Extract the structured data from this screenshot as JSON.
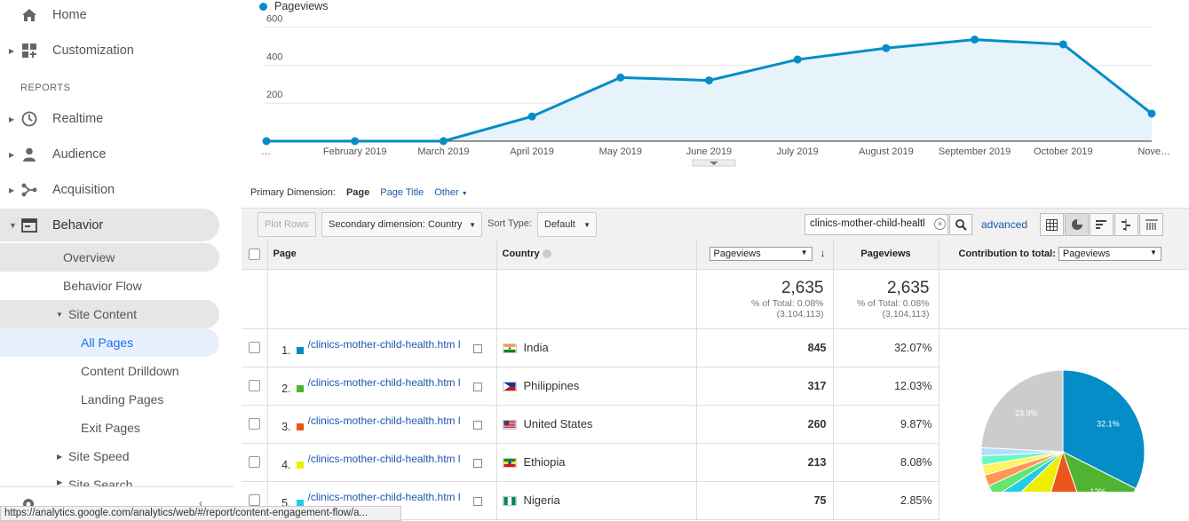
{
  "sidebar": {
    "home": "Home",
    "customization": "Customization",
    "section": "REPORTS",
    "realtime": "Realtime",
    "audience": "Audience",
    "acquisition": "Acquisition",
    "behavior": "Behavior",
    "overview": "Overview",
    "behavior_flow": "Behavior Flow",
    "site_content": "Site Content",
    "all_pages": "All Pages",
    "content_drilldown": "Content Drilldown",
    "landing_pages": "Landing Pages",
    "exit_pages": "Exit Pages",
    "site_speed": "Site Speed",
    "site_search": "Site Search"
  },
  "chart_data": {
    "type": "area",
    "series": [
      {
        "name": "Pageviews",
        "values": [
          0,
          0,
          0,
          130,
          335,
          320,
          430,
          490,
          535,
          510,
          145
        ]
      }
    ],
    "categories": [
      "…",
      "February 2019",
      "March 2019",
      "April 2019",
      "May 2019",
      "June 2019",
      "July 2019",
      "August 2019",
      "September 2019",
      "October 2019",
      "Nove…"
    ],
    "yticks": [
      200,
      400,
      600
    ],
    "ylim": [
      0,
      650
    ],
    "color": "#058dc7",
    "fill": "#e6f3fa",
    "grid": true,
    "legend": "top-left"
  },
  "dimension": {
    "label": "Primary Dimension:",
    "current": "Page",
    "page_title": "Page Title",
    "other": "Other"
  },
  "toolbar": {
    "plot_rows": "Plot Rows",
    "secondary": "Secondary dimension: Country",
    "sort_label": "Sort Type:",
    "sort_value": "Default",
    "search_value": "clinics-mother-child-healtl",
    "advanced": "advanced"
  },
  "table": {
    "headers": {
      "page": "Page",
      "country": "Country",
      "metric_select": "Pageviews",
      "pageviews": "Pageviews",
      "contribution_label": "Contribution to total:",
      "contribution_select": "Pageviews"
    },
    "summary": {
      "total1": "2,635",
      "pct1": "% of Total: 0.08%",
      "abs1": "(3,104,113)",
      "total2": "2,635",
      "pct2": "% of Total: 0.08%",
      "abs2": "(3,104,113)"
    },
    "rows": [
      {
        "index": "1.",
        "page": "/clinics-mother-child-health.htm l",
        "country": "India",
        "views": "845",
        "pct": "32.07%",
        "color": "#058dc7"
      },
      {
        "index": "2.",
        "page": "/clinics-mother-child-health.htm l",
        "country": "Philippines",
        "views": "317",
        "pct": "12.03%",
        "color": "#50b432"
      },
      {
        "index": "3.",
        "page": "/clinics-mother-child-health.htm l",
        "country": "United States",
        "views": "260",
        "pct": "9.87%",
        "color": "#ed561b"
      },
      {
        "index": "4.",
        "page": "/clinics-mother-child-health.htm l",
        "country": "Ethiopia",
        "views": "213",
        "pct": "8.08%",
        "color": "#edef00"
      },
      {
        "index": "5.",
        "page": "/clinics-mother-child-health.htm l",
        "country": "Nigeria",
        "views": "75",
        "pct": "2.85%",
        "color": "#24cbe5"
      }
    ]
  },
  "pie": {
    "slices": [
      {
        "value": 32.07,
        "color": "#058dc7",
        "label": "32.1%"
      },
      {
        "value": 12.03,
        "color": "#50b432",
        "label": "12%"
      },
      {
        "value": 9.87,
        "color": "#ed561b",
        "label": "9.9%"
      },
      {
        "value": 8.08,
        "color": "#edef00",
        "label": "8.1%"
      },
      {
        "value": 2.85,
        "color": "#24cbe5",
        "label": ""
      },
      {
        "value": 2.4,
        "color": "#64e572",
        "label": ""
      },
      {
        "value": 2.2,
        "color": "#ff9655",
        "label": ""
      },
      {
        "value": 2.0,
        "color": "#fff263",
        "label": ""
      },
      {
        "value": 1.8,
        "color": "#6af9c4",
        "label": ""
      },
      {
        "value": 1.6,
        "color": "#b2deff",
        "label": ""
      },
      {
        "value": 23.9,
        "color": "#cccccc",
        "label": "23.9%"
      }
    ]
  },
  "status": {
    "url": "https://analytics.google.com/analytics/web/#/report/content-engagement-flow/a..."
  }
}
